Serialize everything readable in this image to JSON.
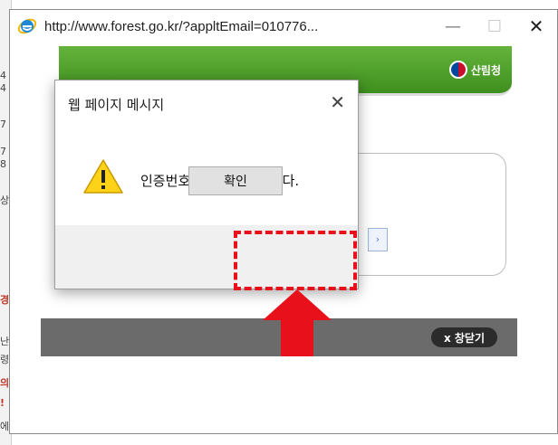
{
  "background": {
    "left_fragments": [
      "4",
      "4",
      "7",
      "7",
      "8",
      "상",
      "경",
      "난",
      "령",
      "의",
      "!",
      "에"
    ],
    "close_window_label": "x 창닫기",
    "small_button_glyph": "›"
  },
  "browser": {
    "url": "http://www.forest.go.kr/?appltEmail=010776...",
    "minimize_glyph": "—",
    "maximize_glyph": "☐",
    "close_glyph": "✕"
  },
  "banner": {
    "logo_text": "산림청"
  },
  "dialog": {
    "title": "웹 페이지 메시지",
    "close_glyph": "✕",
    "message": "인증번호가 확인되었습니다.",
    "ok_label": "확인",
    "icon": "warning-icon"
  },
  "annotation": {
    "highlight_color": "#e8111b",
    "arrow_color": "#e8111b"
  }
}
